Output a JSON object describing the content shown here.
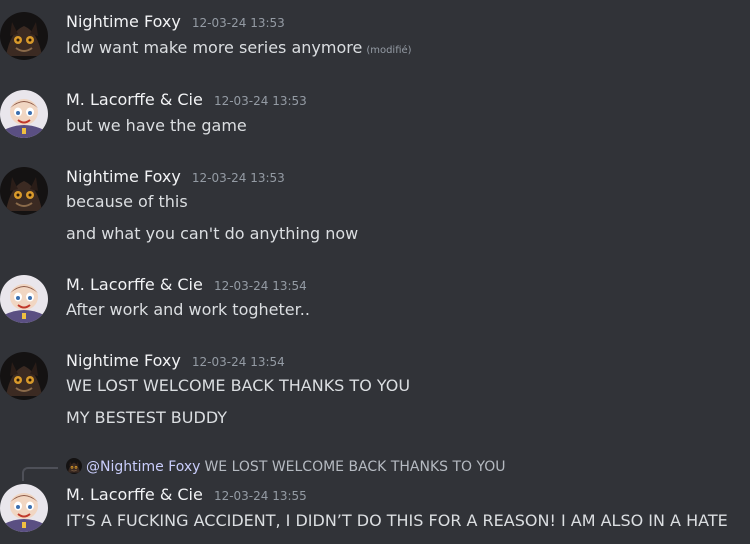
{
  "users": {
    "foxy": "Nightime Foxy",
    "lacorffe": "M. Lacorffe & Cie"
  },
  "messages": [
    {
      "author": "Nightime Foxy",
      "timestamp": "12-03-24 13:53",
      "lines": [
        "Idw want make more series anymore"
      ],
      "edited_label": "(modifié)"
    },
    {
      "author": "M. Lacorffe & Cie",
      "timestamp": "12-03-24 13:53",
      "lines": [
        "but we have the game"
      ]
    },
    {
      "author": "Nightime Foxy",
      "timestamp": "12-03-24 13:53",
      "lines": [
        "because of this",
        "and what you can't do anything now"
      ]
    },
    {
      "author": "M. Lacorffe & Cie",
      "timestamp": "12-03-24 13:54",
      "lines": [
        "After work and work togheter.."
      ]
    },
    {
      "author": "Nightime Foxy",
      "timestamp": "12-03-24 13:54",
      "lines": [
        "WE LOST WELCOME BACK THANKS TO YOU",
        "MY BESTEST BUDDY"
      ]
    },
    {
      "author": "M. Lacorffe & Cie",
      "timestamp": "12-03-24 13:55",
      "reply": {
        "mention": "@Nightime Foxy",
        "text": "WE LOST WELCOME BACK THANKS TO YOU"
      },
      "lines": [
        "IT’S A FUCKING ACCIDENT, I DIDN’T DO THIS FOR A REASON! I AM ALSO IN A HATE"
      ]
    }
  ],
  "colors": {
    "background": "#313338",
    "username": "#f2f3f5",
    "timestamp": "#949ba4",
    "text": "#dbdee1",
    "mention": "#c9cdfb"
  },
  "icons": {
    "foxy_avatar": "dark-fox-avatar-icon",
    "lacorffe_avatar": "cartoon-character-avatar-icon"
  }
}
